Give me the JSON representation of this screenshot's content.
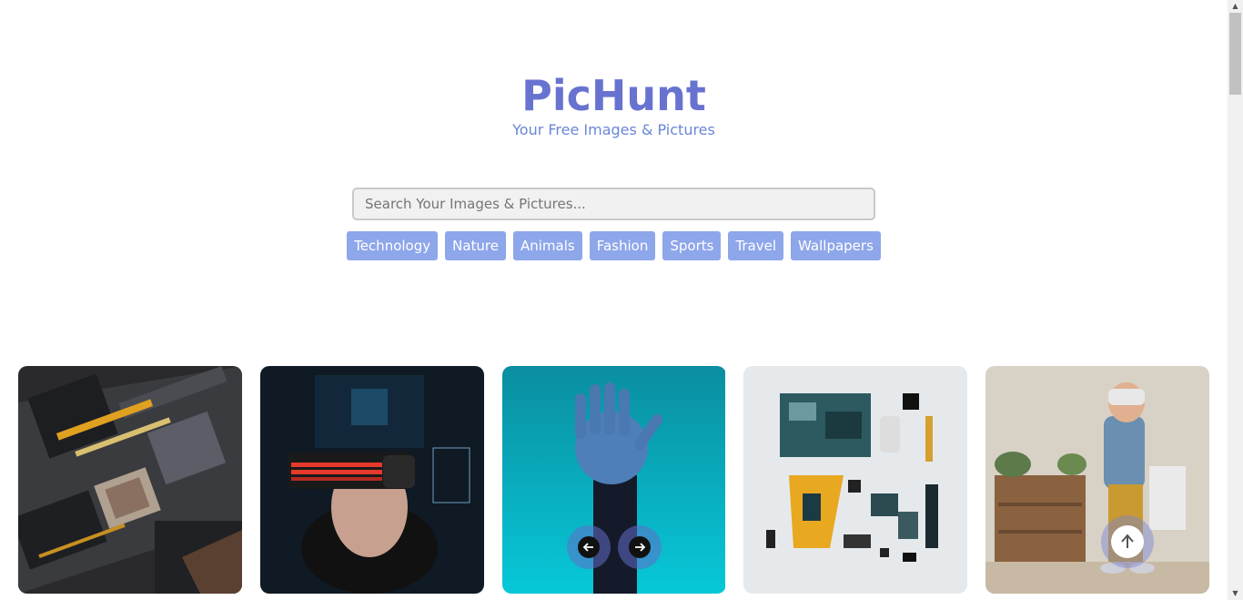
{
  "brand": {
    "title": "PicHunt",
    "subtitle": "Your Free Images & Pictures"
  },
  "search": {
    "placeholder": "Search Your Images & Pictures...",
    "value": ""
  },
  "categories": [
    {
      "label": "Technology"
    },
    {
      "label": "Nature"
    },
    {
      "label": "Animals"
    },
    {
      "label": "Fashion"
    },
    {
      "label": "Sports"
    },
    {
      "label": "Travel"
    },
    {
      "label": "Wallpapers"
    }
  ],
  "gallery": {
    "images": [
      {
        "subject": "circuit-board"
      },
      {
        "subject": "man-vr-headset"
      },
      {
        "subject": "robot-hand"
      },
      {
        "subject": "phone-components"
      },
      {
        "subject": "boy-vr-headset"
      }
    ]
  },
  "controls": {
    "prev_icon": "arrow-left-icon",
    "next_icon": "arrow-right-icon",
    "top_icon": "arrow-up-icon"
  },
  "colors": {
    "brand": "#6873d0",
    "subtitle": "#6a86d6",
    "category_button": "#8ea6ea"
  }
}
